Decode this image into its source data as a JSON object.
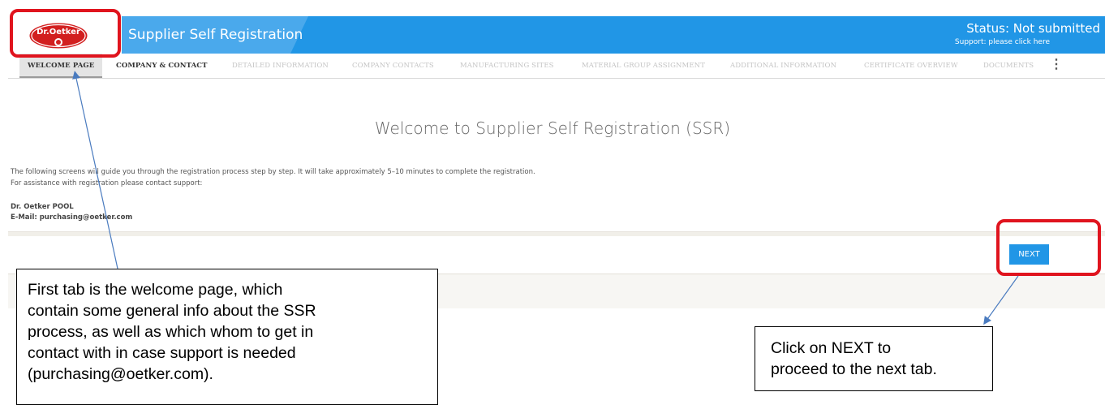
{
  "header": {
    "logo_text": "Dr.Oetker",
    "app_title": "Supplier Self Registration",
    "status": "Status: Not submitted",
    "support_link": "Support: please click here"
  },
  "tabs": [
    {
      "label": "WELCOME PAGE",
      "active": true
    },
    {
      "label": "COMPANY & CONTACT",
      "active": false
    },
    {
      "label": "DETAILED INFORMATION",
      "active": false
    },
    {
      "label": "COMPANY CONTACTS",
      "active": false
    },
    {
      "label": "MANUFACTURING SITES",
      "active": false
    },
    {
      "label": "MATERIAL GROUP ASSIGNMENT",
      "active": false
    },
    {
      "label": "ADDITIONAL INFORMATION",
      "active": false
    },
    {
      "label": "CERTIFICATE OVERVIEW",
      "active": false
    },
    {
      "label": "DOCUMENTS",
      "active": false
    }
  ],
  "tab_more_icon": "more-vertical-icon",
  "main": {
    "title": "Welcome to Supplier Self Registration (SSR)",
    "intro_line1": "The following screens will guide you through the registration process step by step. It will take approximately 5–10 minutes to complete the registration.",
    "intro_line2": "For assistance with registration please contact support:",
    "contact_name": "Dr. Oetker POOL",
    "contact_email": "E-Mail: purchasing@oetker.com"
  },
  "actions": {
    "next_label": "NEXT"
  },
  "callouts": {
    "left": [
      "First tab is the welcome page, which",
      "contain some general info about the SSR",
      "process, as well as which whom to get in",
      "contact with in case support is needed",
      "(purchasing@oetker.com)."
    ],
    "right": [
      "Click on NEXT to",
      "proceed to the next tab."
    ]
  },
  "colors": {
    "header_blue": "#2196e6",
    "highlight_red": "#e0141e",
    "next_button": "#2196e6",
    "logo_red": "#d21f1f"
  }
}
